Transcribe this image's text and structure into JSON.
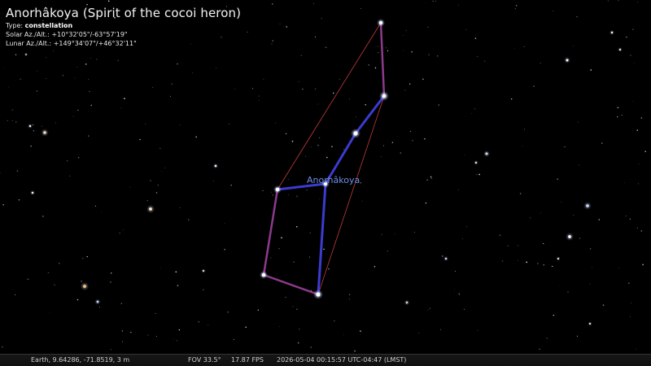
{
  "object": {
    "title": "Anorhâkoya (Spirit of the cocoi heron)",
    "type_label": "Type:",
    "type_value": "constellation",
    "solar_label": "Solar Az./Alt.:",
    "solar_value": "+10°32'05\"/-63°57'19\"",
    "lunar_label": "Lunar Az./Alt.:",
    "lunar_value": "+149°34'07\"/+46°32'11\""
  },
  "constellation": {
    "label": "Anorhâkoya",
    "label_color": "#6f8fe8",
    "stick_color": "#3b3bd0",
    "alt_stick_color": "#8c3a8c",
    "boundary_color": "#c03a3a"
  },
  "status": {
    "location": "Earth, 9.64286, -71.8519, 3 m",
    "fov": "FOV 33.5°",
    "fps": "17.87 FPS",
    "datetime": "2026-05-04 00:15:57 UTC-04:47 (LMST)"
  }
}
